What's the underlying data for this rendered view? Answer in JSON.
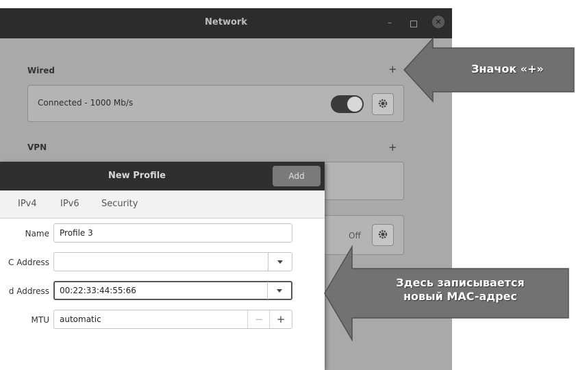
{
  "network_window": {
    "title": "Network",
    "wired": {
      "label": "Wired",
      "add_symbol": "+",
      "connection_status": "Connected - 1000 Mb/s",
      "toggle_on": true
    },
    "vpn": {
      "label": "VPN",
      "add_symbol": "+"
    },
    "proxy": {
      "status": "Off"
    }
  },
  "new_profile_dialog": {
    "title": "New Profile",
    "add_button": "Add",
    "tabs": [
      "IPv4",
      "IPv6",
      "Security"
    ],
    "fields": {
      "name_label": "Name",
      "name_value": "Profile 3",
      "mac_label": "C Address",
      "mac_value": "",
      "cloned_label": "d Address",
      "cloned_value": "00:22:33:44:55:66",
      "mtu_label": "MTU",
      "mtu_value": "automatic",
      "mtu_minus": "−",
      "mtu_plus": "+"
    }
  },
  "annotations": {
    "plus_callout": "Значок «+»",
    "mac_callout_line1": "Здесь записывается",
    "mac_callout_line2": "новый MAC-адрес"
  }
}
